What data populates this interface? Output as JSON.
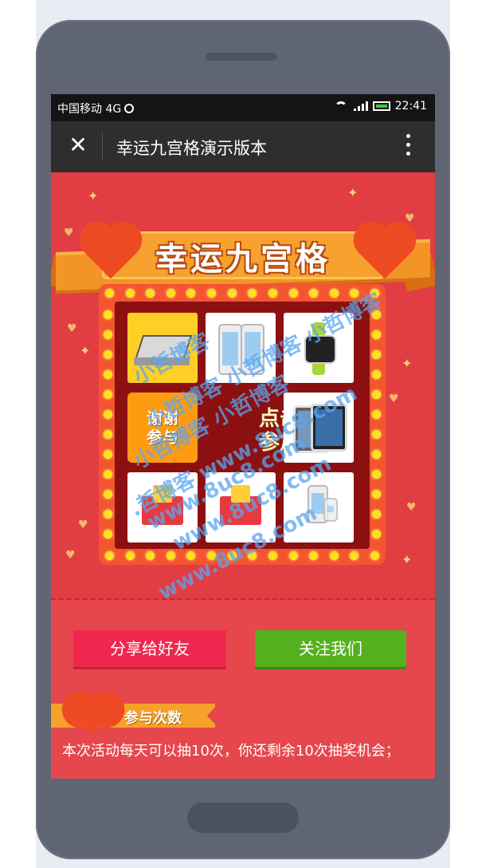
{
  "status_bar": {
    "carrier": "中国移动 4G",
    "time": "22:41",
    "icons": [
      "sync-icon",
      "wifi-icon",
      "signal-icon",
      "battery-icon"
    ]
  },
  "title_bar": {
    "close_icon": "close-icon",
    "title": "幸运九宫格演示版本",
    "more_icon": "more-vertical-icon"
  },
  "game": {
    "banner_title": "幸运九宫格",
    "cells": [
      {
        "id": "laptop",
        "label": "",
        "active": true
      },
      {
        "id": "phone",
        "label": ""
      },
      {
        "id": "smartwatch",
        "label": ""
      },
      {
        "id": "thanks",
        "label": "谢谢参与"
      },
      {
        "id": "start",
        "label": "点击参加"
      },
      {
        "id": "tablet",
        "label": ""
      },
      {
        "id": "red-envelope-1",
        "label": ""
      },
      {
        "id": "red-envelope-2",
        "label": ""
      },
      {
        "id": "phone-2",
        "label": ""
      }
    ],
    "start_label_line1": "点击",
    "start_label_line2": "参加",
    "thanks_label_line1": "谢谢",
    "thanks_label_line2": "参与"
  },
  "watermarks": [
    "小哲博客",
    "小哲博客 小哲博客 小哲博客",
    "小哲博客 小哲博客",
    ".哲博客 www.8uc8.com",
    "www.8uc8.com",
    "www.8uc8.com",
    "www.8uc8.com"
  ],
  "actions": {
    "share_label": "分享给好友",
    "follow_label": "关注我们"
  },
  "section": {
    "title": "参与次数",
    "rule_text": "本次活动每天可以抽10次，你还剩余10次抽奖机会；"
  },
  "colors": {
    "background_red": "#e23d43",
    "ribbon_orange": "#f39524",
    "board_dark": "#8d1011",
    "share_button": "#f0284f",
    "follow_button": "#55b01f",
    "bulb_yellow": "#ffe11b"
  }
}
